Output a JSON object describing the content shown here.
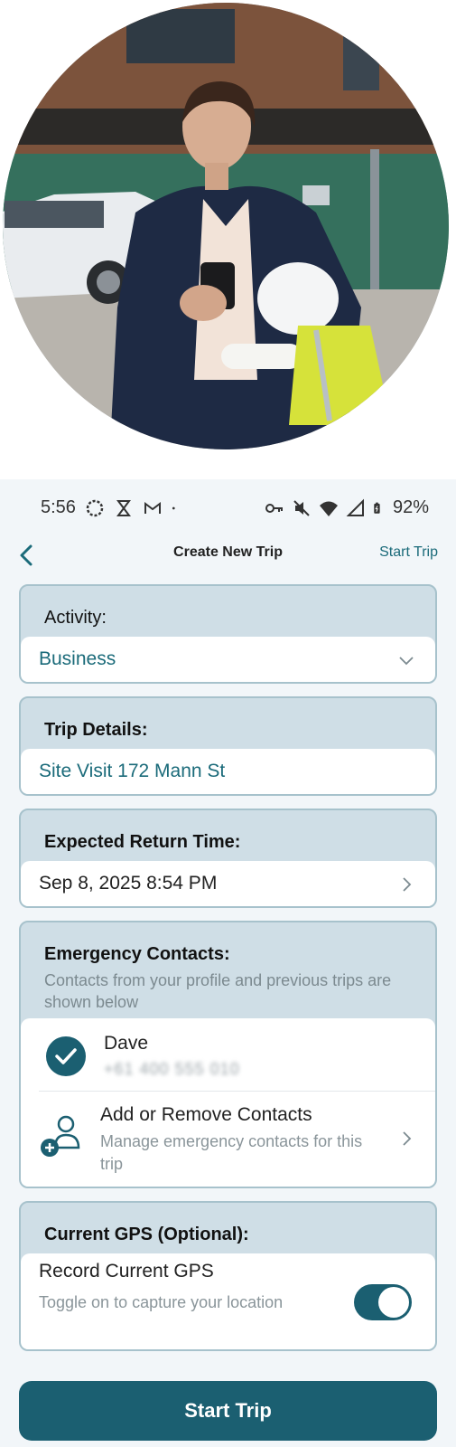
{
  "status_bar": {
    "time": "5:56",
    "battery": "92%"
  },
  "nav": {
    "title": "Create New Trip",
    "action": "Start Trip"
  },
  "activity": {
    "label": "Activity:",
    "value": "Business"
  },
  "trip_details": {
    "label": "Trip Details:",
    "value": "Site Visit 172 Mann St"
  },
  "return_time": {
    "label": "Expected Return Time:",
    "value": "Sep 8, 2025 8:54 PM"
  },
  "contacts": {
    "label": "Emergency Contacts:",
    "subtitle": "Contacts from your profile and previous trips are shown below",
    "items": [
      {
        "name": "Dave",
        "phone": "+61 400 555 010",
        "checked": true
      }
    ],
    "add_title": "Add or Remove Contacts",
    "add_subtitle": "Manage emergency contacts for this trip"
  },
  "gps": {
    "label": "Current GPS (Optional):",
    "toggle_title": "Record Current GPS",
    "toggle_subtitle": "Toggle on to capture your location",
    "enabled": true
  },
  "primary_button": "Start Trip",
  "colors": {
    "accent": "#1b5f71",
    "accent_text": "#1b6b7a",
    "card_bg": "#cfdee6",
    "screen_bg": "#f2f6f9"
  }
}
